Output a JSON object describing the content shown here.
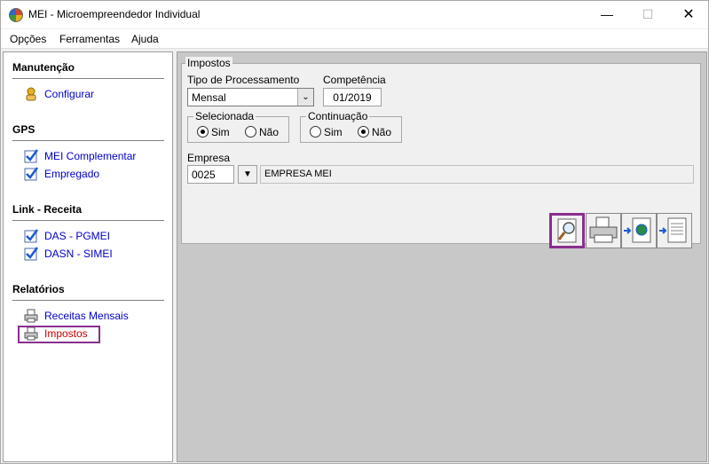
{
  "window": {
    "title": "MEI - Microempreendedor Individual"
  },
  "menu": [
    "Opções",
    "Ferramentas",
    "Ajuda"
  ],
  "sidebar": {
    "sections": [
      {
        "title": "Manutenção",
        "items": [
          {
            "label": "Configurar",
            "icon": "gear-hand-icon"
          }
        ]
      },
      {
        "title": "GPS",
        "items": [
          {
            "label": "MEI Complementar",
            "icon": "checklist-icon"
          },
          {
            "label": "Empregado",
            "icon": "checklist-icon"
          }
        ]
      },
      {
        "title": "Link - Receita",
        "items": [
          {
            "label": "DAS - PGMEI",
            "icon": "checklist-icon"
          },
          {
            "label": "DASN - SIMEI",
            "icon": "checklist-icon"
          }
        ]
      },
      {
        "title": "Relatórios",
        "items": [
          {
            "label": "Receitas Mensais",
            "icon": "printer-icon"
          },
          {
            "label": "Impostos",
            "icon": "printer-icon",
            "selected": true
          }
        ]
      }
    ]
  },
  "form": {
    "group_title": "Impostos",
    "tipo_label": "Tipo de Processamento",
    "tipo_value": "Mensal",
    "competencia_label": "Competência",
    "competencia_value": "01/2019",
    "selecionada_label": "Selecionada",
    "continuacao_label": "Continuação",
    "sim_label": "Sim",
    "nao_label": "Não",
    "selecionada_value": "Sim",
    "continuacao_value": "Não",
    "empresa_label": "Empresa",
    "empresa_code": "0025",
    "empresa_name": "EMPRESA MEI"
  },
  "toolbar": [
    "preview-icon",
    "printer-icon",
    "export-web-icon",
    "export-document-icon"
  ],
  "colors": {
    "highlight": "#8a2e8e",
    "link": "#0000cc"
  }
}
